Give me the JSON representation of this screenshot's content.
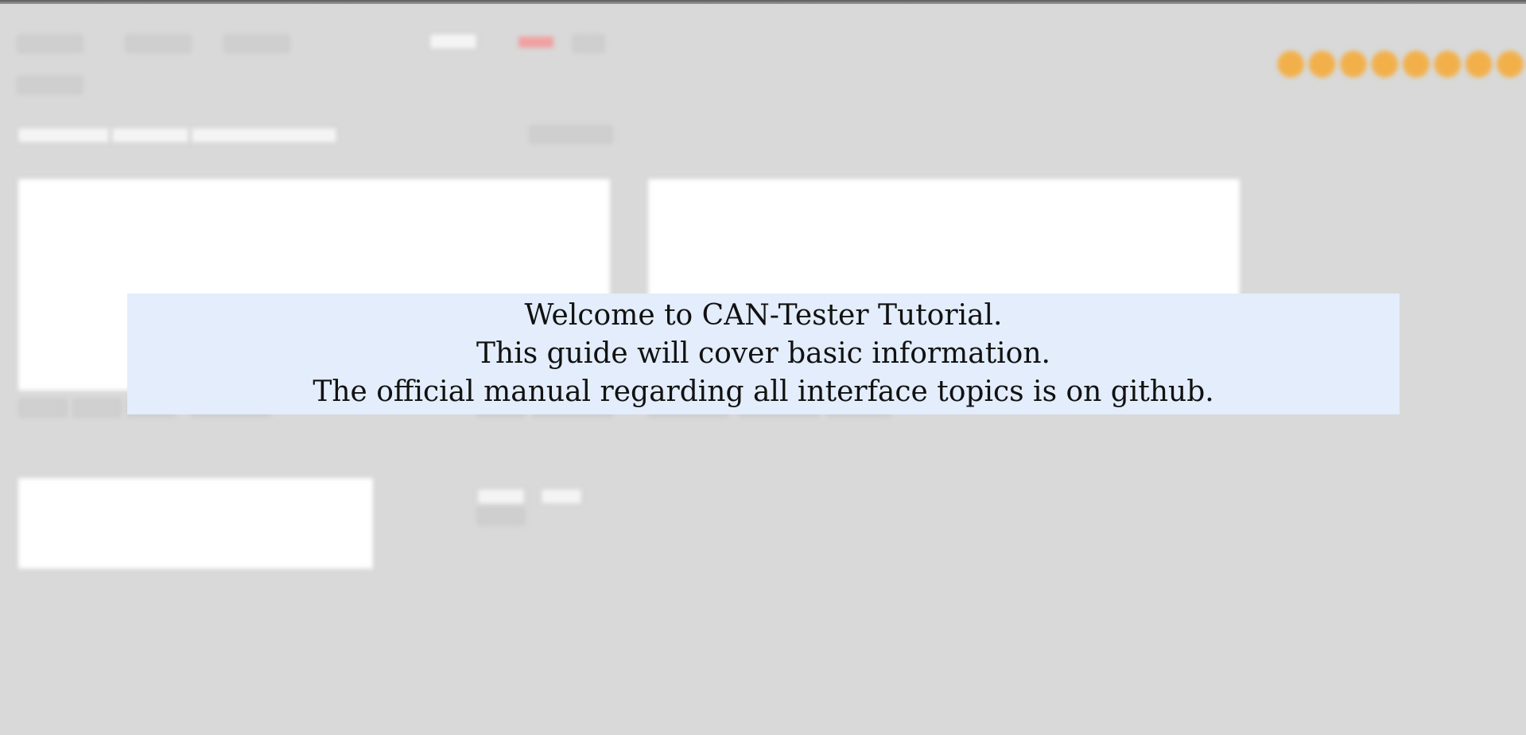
{
  "tutorial": {
    "lines": [
      "Welcome to CAN-Tester Tutorial.",
      "This guide will cover basic information.",
      "The official manual regarding all interface topics is on github."
    ]
  },
  "colors": {
    "background": "#d9d9d9",
    "overlay": "#e3edfb",
    "brand_logo": "#f2b04a",
    "status_indicator": "#f0a0a0"
  }
}
